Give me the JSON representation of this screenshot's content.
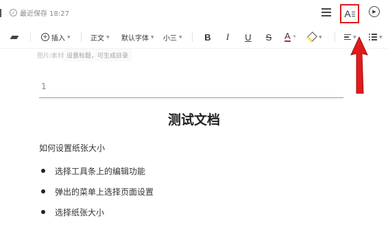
{
  "status": {
    "save_text": "最近保存 18:27"
  },
  "toolbar": {
    "insert_label": "插入",
    "paragraph_label": "正文",
    "font_label": "默认字体",
    "size_label": "小三",
    "bold": "B",
    "italic": "I",
    "underline": "U",
    "strikethrough": "S",
    "font_color": "A"
  },
  "top_actions": {
    "font_style_glyph": "A"
  },
  "tooltip": {
    "faded_text": "图片/素材",
    "main_text": "设置标题，可生成目录"
  },
  "document": {
    "line_number": "1",
    "title": "测试文档",
    "paragraph": "如何设置纸张大小",
    "bullets": [
      "选择工具条上的编辑功能",
      "弹出的菜单上选择页面设置",
      "选择纸张大小"
    ]
  },
  "colors": {
    "annotation_red": "#e01b1b",
    "font_color_underline": "#e01b1b",
    "highlight_yellow": "#f3e34a"
  }
}
